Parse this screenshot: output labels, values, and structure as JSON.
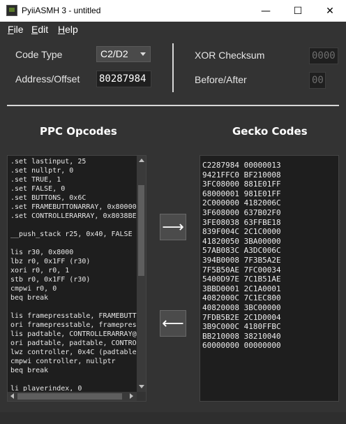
{
  "window": {
    "title": "PyiiASMH 3 - untitled",
    "minimize": "—",
    "maximize": "☐",
    "close": "✕"
  },
  "menu": [
    {
      "key": "F",
      "rest": "ile"
    },
    {
      "key": "E",
      "rest": "dit"
    },
    {
      "key": "H",
      "rest": "elp"
    }
  ],
  "settings": {
    "code_type_label": "Code Type",
    "code_type_value": "C2/D2",
    "address_label": "Address/Offset",
    "address_value": "80287984",
    "xor_label": "XOR Checksum",
    "xor_value": "0000",
    "before_after_label": "Before/After",
    "before_after_value": "00"
  },
  "ppc": {
    "heading": "PPC Opcodes",
    "lines": [
      ".set lastinput, 25",
      ".set nullptr, 0",
      ".set TRUE, 1",
      ".set FALSE, 0",
      ".set BUTTONS, 0x6C",
      ".set FRAMEBUTTONARRAY, 0x80000",
      ".set CONTROLLERARRAY, 0x8038BE",
      "",
      "__push_stack r25, 0x40, FALSE",
      "",
      "lis r30, 0x8000",
      "lbz r0, 0x1FF (r30)",
      "xori r0, r0, 1",
      "stb r0, 0x1FF (r30)",
      "cmpwi r0, 0",
      "beq break",
      "",
      "lis framepresstable, FRAMEBUTTO",
      "ori framepresstable, framepres",
      "lis padtable, CONTROLLERARRAY@",
      "ori padtable, padtable, CONTRO",
      "lwz controller, 0x4C (padtable",
      "cmpwi controller, nullptr",
      "beq break",
      "",
      "li playerindex, 0"
    ]
  },
  "buttons": {
    "to_gecko": "⟶",
    "to_ppc": "⟵"
  },
  "gecko": {
    "heading": "Gecko Codes",
    "lines": [
      "C2287984 00000013",
      "9421FFC0 BF210008",
      "3FC08000 881E01FF",
      "68000001 981E01FF",
      "2C000000 4182006C",
      "3F608000 637B02F0",
      "3FE08038 63FFBE18",
      "839F004C 2C1C0000",
      "41820050 3BA00000",
      "57AB083C A3DC006C",
      "394B0008 7F3B5A2E",
      "7F5B50AE 7FC00034",
      "5400D97E 7C1B51AE",
      "3BBD0001 2C1A0001",
      "4082000C 7C1EC800",
      "40820008 3BC00000",
      "7FDB5B2E 2C1D0004",
      "3B9C000C 4180FFBC",
      "BB210008 38210040",
      "60000000 00000000"
    ]
  },
  "colors": {
    "background": "#333333",
    "pane": "#1e1e1e",
    "address_text": "#ffffff",
    "checksum_text": "#6e6e6e"
  }
}
